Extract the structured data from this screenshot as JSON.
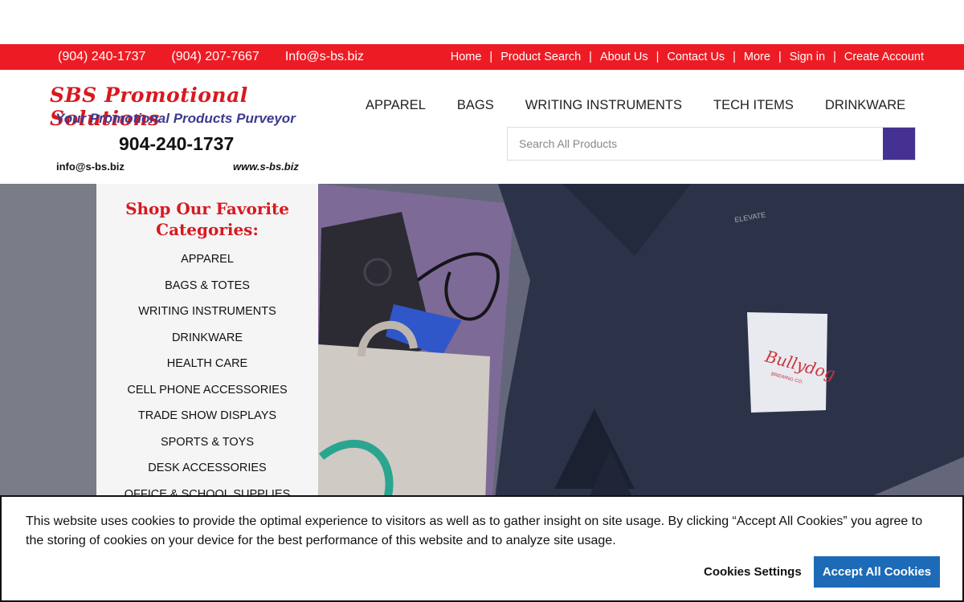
{
  "topbar": {
    "phone1": "(904) 240-1737",
    "phone2": "(904) 207-7667",
    "email": "Info@s-bs.biz",
    "links": [
      "Home",
      "Product Search",
      "About Us",
      "Contact Us",
      "More",
      "Sign in",
      "Create Account"
    ],
    "separator": "|"
  },
  "logo": {
    "company": "SBS Promotional Solutions",
    "tagline": "Your Promotional Products Purveyor",
    "phone": "904-240-1737",
    "email": "info@s-bs.biz",
    "website": "www.s-bs.biz"
  },
  "nav": {
    "items": [
      "APPAREL",
      "BAGS",
      "WRITING INSTRUMENTS",
      "TECH ITEMS",
      "DRINKWARE"
    ]
  },
  "search": {
    "placeholder": "Search All Products"
  },
  "sidebar": {
    "title": "Shop Our Favorite Categories:",
    "categories": [
      "APPAREL",
      "BAGS & TOTES",
      "WRITING INSTRUMENTS",
      "DRINKWARE",
      "HEALTH CARE",
      "CELL PHONE ACCESSORIES",
      "TRADE SHOW DISPLAYS",
      "SPORTS & TOYS",
      "DESK ACCESSORIES",
      "OFFICE & SCHOOL SUPPLIES"
    ]
  },
  "hero": {
    "shirt_brand": "ELEVATE",
    "pocket_logo": "Bullydog",
    "pocket_sub": "BREWING CO."
  },
  "cookie": {
    "message": "This website uses cookies to provide the optimal experience to visitors as well as to gather insight on site usage. By clicking “Accept All Cookies” you agree to the storing of cookies on your device for the best performance of this website and to analyze site usage.",
    "settings_label": "Cookies Settings",
    "accept_label": "Accept All Cookies"
  },
  "colors": {
    "brand_red": "#ed1c24",
    "brand_purple": "#453192",
    "accept_blue": "#1d6ab7"
  }
}
